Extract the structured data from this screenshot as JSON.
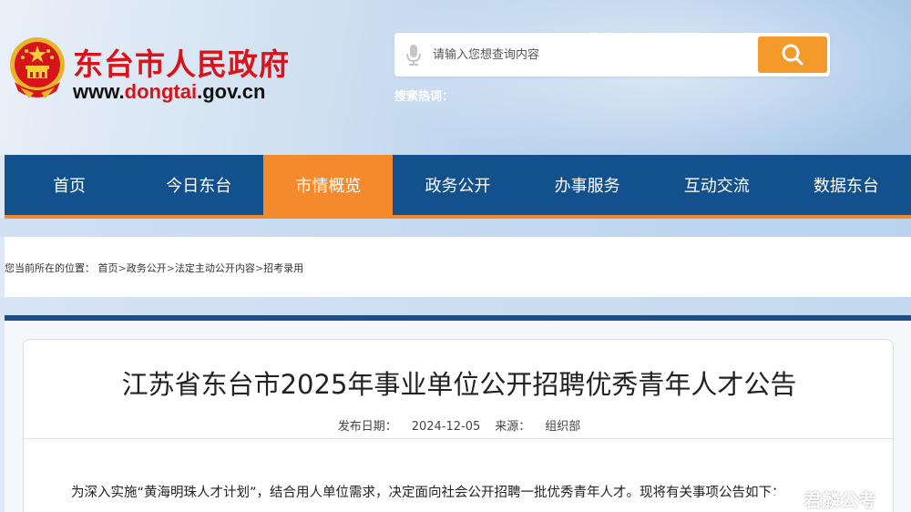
{
  "header": {
    "site_title": "东台市人民政府",
    "site_url_prefix": "www.",
    "site_url_accent": "dongtai",
    "site_url_suffix": ".gov.cn",
    "search_placeholder": "请输入您想查询内容",
    "hot_words_label": "搜索热词："
  },
  "nav": {
    "items": [
      {
        "label": "首页"
      },
      {
        "label": "今日东台"
      },
      {
        "label": "市情概览",
        "active": true
      },
      {
        "label": "政务公开"
      },
      {
        "label": "办事服务"
      },
      {
        "label": "互动交流"
      },
      {
        "label": "数据东台"
      }
    ]
  },
  "breadcrumb": {
    "prefix": "您当前所在的位置：",
    "items": [
      "首页",
      "政务公开",
      "法定主动公开内容",
      "招考录用"
    ],
    "separator": ">"
  },
  "article": {
    "title": "江苏省东台市2025年事业单位公开招聘优秀青年人才公告",
    "date_label": "发布日期：",
    "date": "2024-12-05",
    "source_label": "来源：",
    "source": "组织部",
    "first_paragraph": "为深入实施“黄海明珠人才计划”，结合用人单位需求，决定面向社会公开招聘一批优秀青年人才。现将有关事项公告如下："
  },
  "watermark": {
    "text": "君麟公考"
  },
  "colors": {
    "brand_red": "#d8141b",
    "nav_blue": "#12508e",
    "nav_active": "#f58a2c",
    "search_button": "#f39a2a"
  },
  "icons": {
    "emblem": "national-emblem-icon",
    "mic": "microphone-icon",
    "search": "magnifier-icon",
    "watermark": "weibo-icon"
  }
}
